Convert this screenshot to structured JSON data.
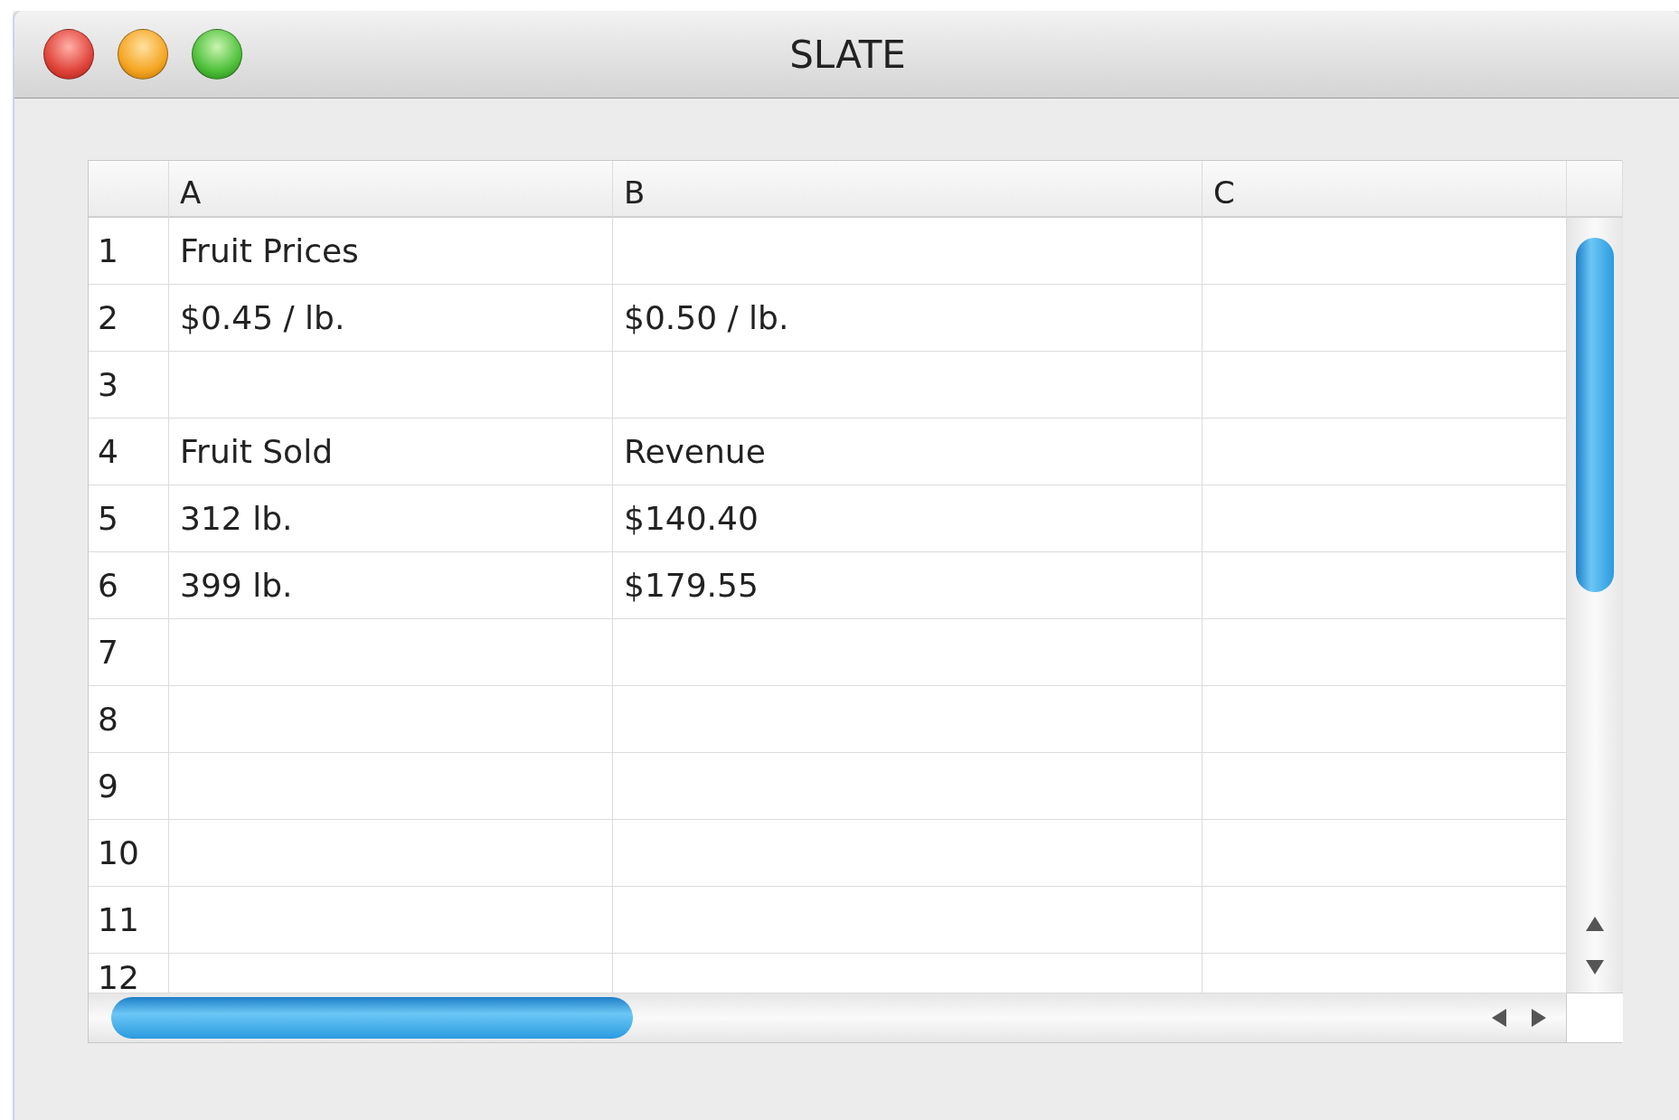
{
  "window": {
    "title": "SLATE"
  },
  "table": {
    "columns": [
      "A",
      "B",
      "C"
    ],
    "rows": [
      {
        "number": "1",
        "column_a": "Fruit Prices"
      },
      {
        "number": "2",
        "column_a": "$0.45 / lb.",
        "column_b": "$0.50 / lb."
      },
      {
        "number": "3"
      },
      {
        "number": "4",
        "column_a": "Fruit Sold",
        "column_b": "Revenue"
      },
      {
        "number": "5",
        "column_a": "312 lb.",
        "column_b": "$140.40"
      },
      {
        "number": "6",
        "column_a": "399 lb.",
        "column_b": "$179.55"
      },
      {
        "number": "7"
      },
      {
        "number": "8"
      },
      {
        "number": "9"
      },
      {
        "number": "10"
      },
      {
        "number": "11"
      },
      {
        "number": "12"
      }
    ]
  }
}
